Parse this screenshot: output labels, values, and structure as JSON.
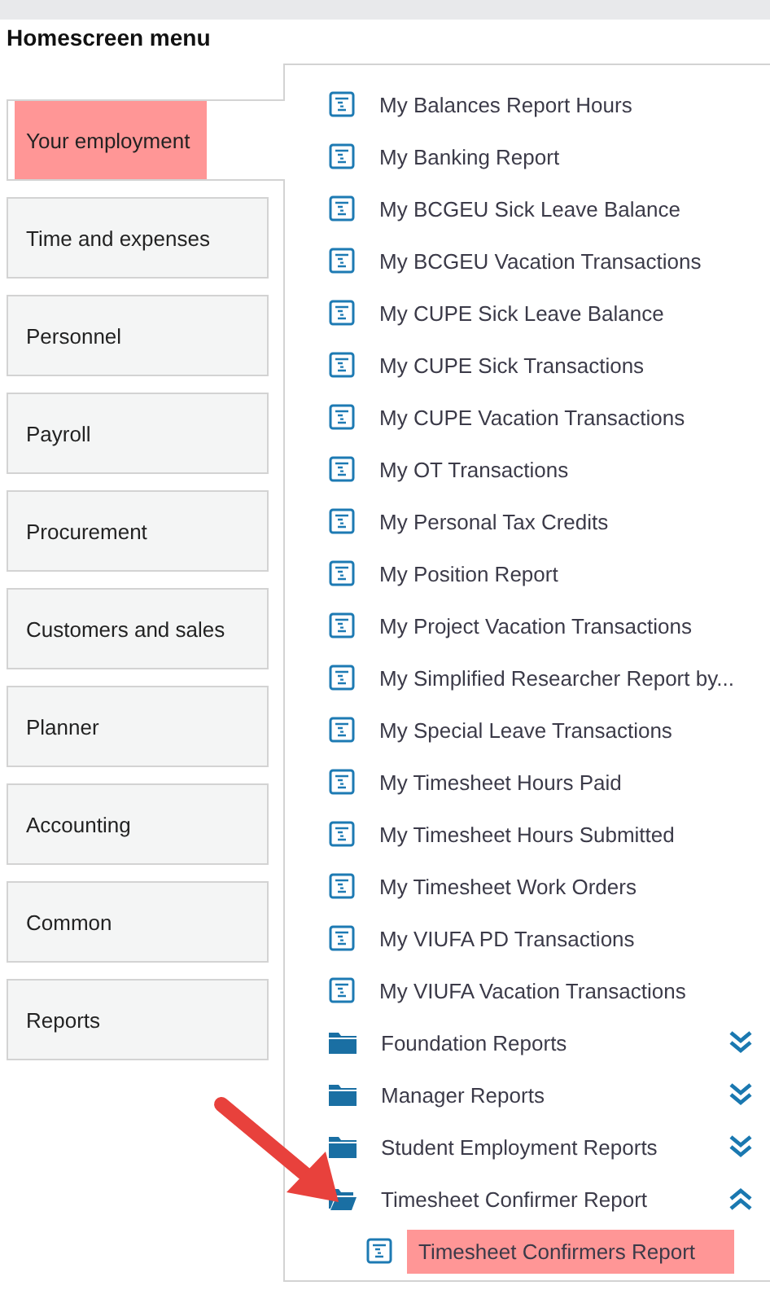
{
  "title": "Homescreen menu",
  "tabs": [
    {
      "label": "Your employment",
      "selected": true,
      "highlighted": true
    },
    {
      "label": "Time and expenses",
      "selected": false,
      "highlighted": false
    },
    {
      "label": "Personnel",
      "selected": false,
      "highlighted": false
    },
    {
      "label": "Payroll",
      "selected": false,
      "highlighted": false
    },
    {
      "label": "Procurement",
      "selected": false,
      "highlighted": false
    },
    {
      "label": "Customers and sales",
      "selected": false,
      "highlighted": false
    },
    {
      "label": "Planner",
      "selected": false,
      "highlighted": false
    },
    {
      "label": "Accounting",
      "selected": false,
      "highlighted": false
    },
    {
      "label": "Common",
      "selected": false,
      "highlighted": false
    },
    {
      "label": "Reports",
      "selected": false,
      "highlighted": false
    }
  ],
  "items": [
    {
      "kind": "report",
      "label": "My Balances Report Hours"
    },
    {
      "kind": "report",
      "label": "My Banking Report"
    },
    {
      "kind": "report",
      "label": "My BCGEU Sick Leave Balance"
    },
    {
      "kind": "report",
      "label": "My BCGEU Vacation Transactions"
    },
    {
      "kind": "report",
      "label": "My CUPE Sick Leave Balance"
    },
    {
      "kind": "report",
      "label": "My CUPE Sick Transactions"
    },
    {
      "kind": "report",
      "label": "My CUPE Vacation Transactions"
    },
    {
      "kind": "report",
      "label": "My OT Transactions"
    },
    {
      "kind": "report",
      "label": "My Personal Tax Credits"
    },
    {
      "kind": "report",
      "label": "My Position Report"
    },
    {
      "kind": "report",
      "label": "My Project Vacation Transactions"
    },
    {
      "kind": "report",
      "label": "My Simplified Researcher Report by..."
    },
    {
      "kind": "report",
      "label": "My Special Leave Transactions"
    },
    {
      "kind": "report",
      "label": "My Timesheet Hours Paid"
    },
    {
      "kind": "report",
      "label": "My Timesheet Hours Submitted"
    },
    {
      "kind": "report",
      "label": "My Timesheet Work Orders"
    },
    {
      "kind": "report",
      "label": "My VIUFA PD Transactions"
    },
    {
      "kind": "report",
      "label": "My VIUFA Vacation Transactions"
    },
    {
      "kind": "folder",
      "label": "Foundation Reports",
      "expanded": false
    },
    {
      "kind": "folder",
      "label": "Manager Reports",
      "expanded": false
    },
    {
      "kind": "folder",
      "label": "Student Employment Reports",
      "expanded": false
    },
    {
      "kind": "folder",
      "label": "Timesheet Confirmer Report",
      "expanded": true,
      "children": [
        {
          "kind": "report",
          "label": "Timesheet Confirmers Report",
          "highlighted": true
        }
      ]
    }
  ]
}
